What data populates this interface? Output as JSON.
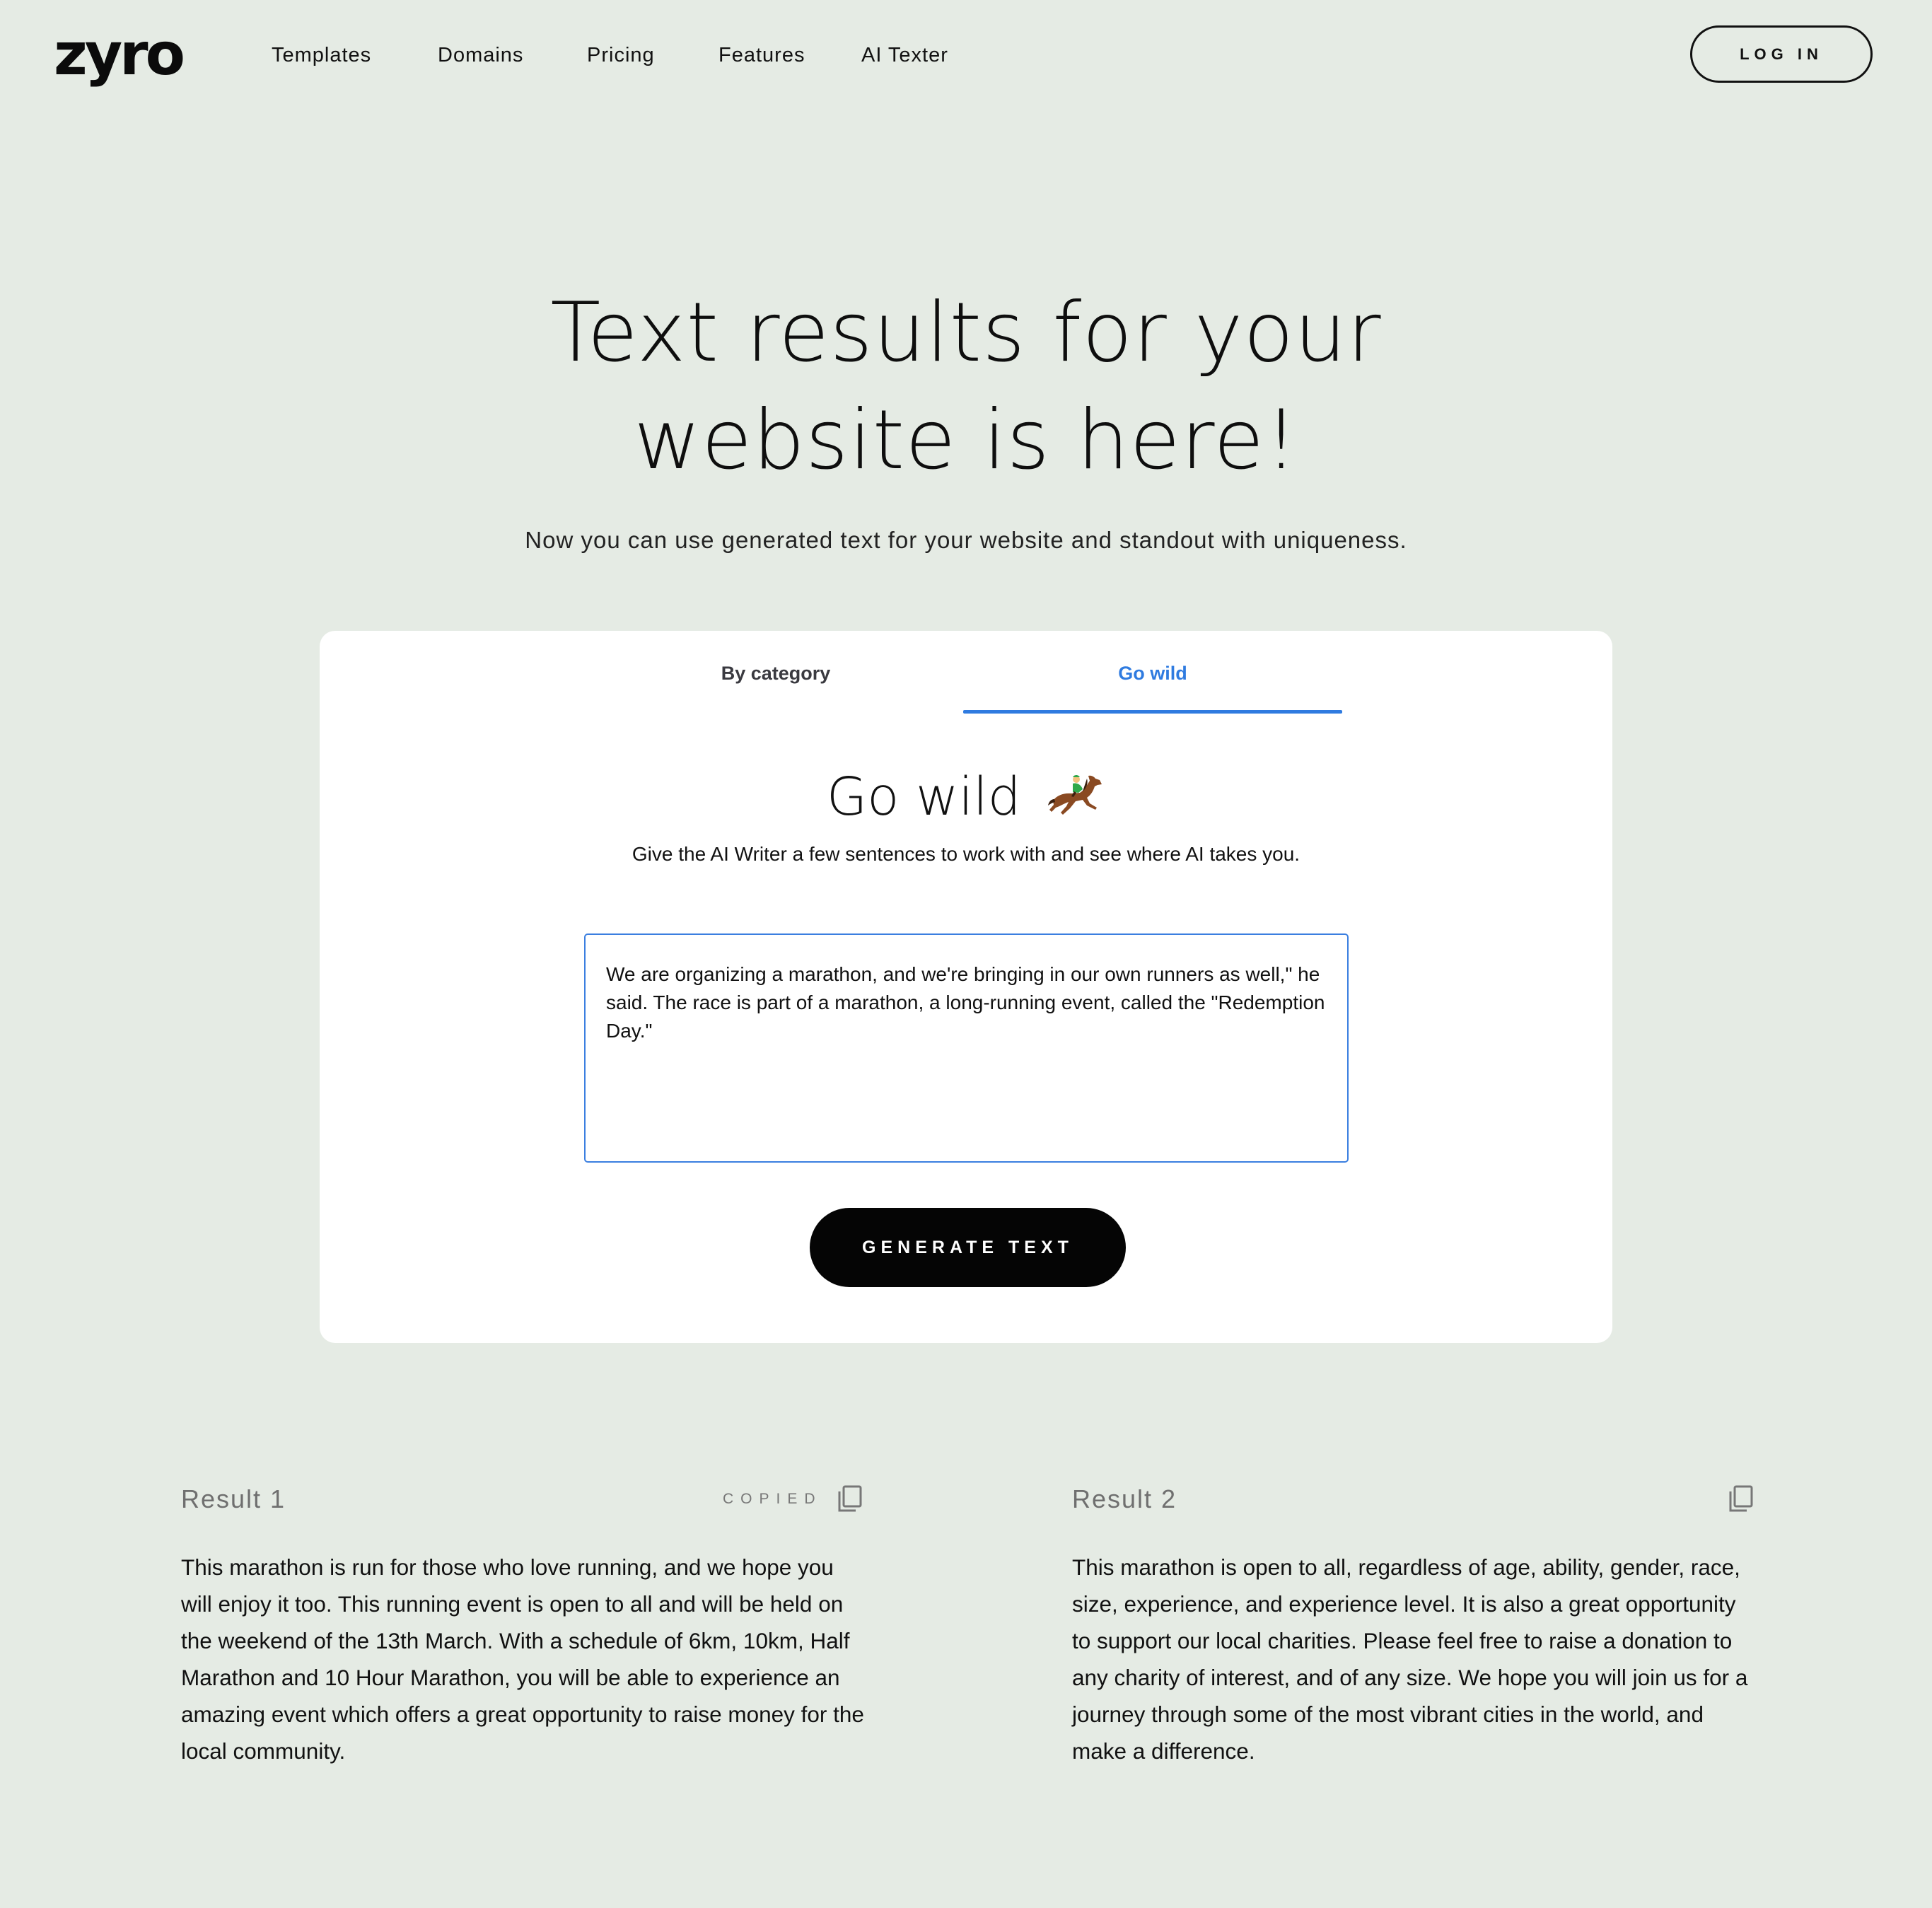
{
  "header": {
    "logo": "zyro",
    "nav": [
      "Templates",
      "Domains",
      "Pricing",
      "Features",
      "AI Texter"
    ],
    "login_label": "LOG IN"
  },
  "hero": {
    "title_line1": "Text results for your",
    "title_line2": "website is here!",
    "subtitle": "Now you can use generated text for your website and standout with uniqueness."
  },
  "card": {
    "tabs": [
      "By category",
      "Go wild"
    ],
    "active_tab": "Go wild",
    "heading": "Go wild",
    "heading_icon": "horse-racing-icon",
    "description": "Give the AI Writer a few sentences to work with and see where AI takes you.",
    "prompt_value": "We are organizing a marathon, and we're bringing in our own runners as well,\" he said. The race is part of a marathon, a long-running event, called the \"Redemption Day.\"",
    "generate_label": "GENERATE TEXT"
  },
  "results": [
    {
      "title": "Result 1",
      "status": "COPIED",
      "icon": "copy-icon",
      "text": "This marathon is run for those who love running, and we hope you will enjoy it too. This running event is open to all and will be held on the weekend of the 13th March.  With a schedule of 6km, 10km, Half Marathon and 10 Hour Marathon, you will be able to experience an amazing event which offers a great opportunity to raise money for the local community."
    },
    {
      "title": "Result 2",
      "status": "",
      "icon": "copy-icon",
      "text": "This marathon is open to all, regardless of age, ability, gender, race, size, experience, and experience level. It is also a great opportunity to support our local charities. Please feel free to raise a donation to any charity of interest, and of any size. We hope you will join us for a journey through some of the most vibrant cities in the world, and make a difference."
    }
  ],
  "colors": {
    "background": "#e5ebe4",
    "accent": "#2f7be0",
    "button": "#050505"
  }
}
